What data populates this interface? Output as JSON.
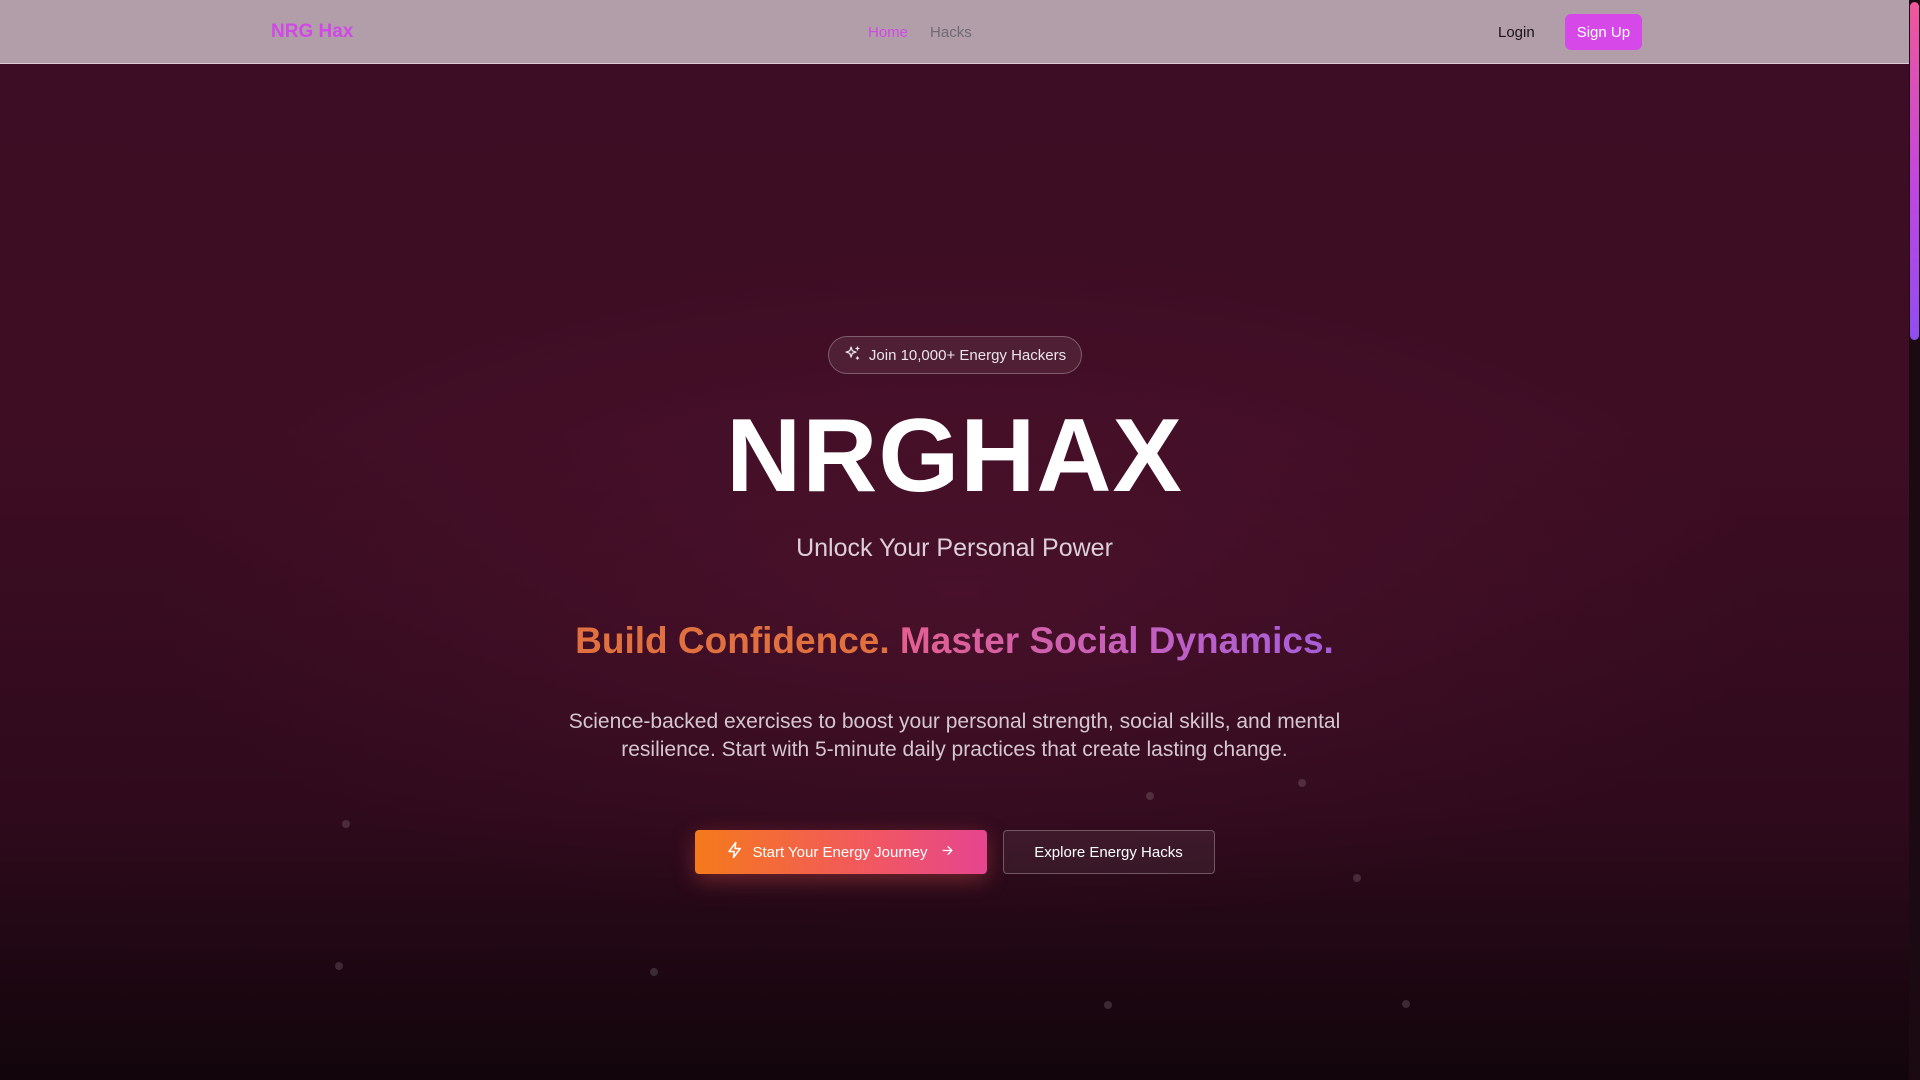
{
  "nav": {
    "brand": "NRG Hax",
    "links": [
      {
        "label": "Home",
        "active": true
      },
      {
        "label": "Hacks",
        "active": false
      }
    ],
    "login_label": "Login",
    "signup_label": "Sign Up"
  },
  "hero": {
    "badge_icon": "sparkles-icon",
    "badge_text": "Join 10,000+ Energy Hackers",
    "title": "NRGHAX",
    "subtitle": "Unlock Your Personal Power",
    "tagline_part1": "Build Confidence.",
    "tagline_part2": "Master Social Dynamics.",
    "description": "Science-backed exercises to boost your personal strength, social skills, and mental resilience. Start with 5-minute daily practices that create lasting change.",
    "primary_cta": {
      "label": "Start Your Energy Journey",
      "icon": "zap-icon",
      "trailing_icon": "arrow-right-icon"
    },
    "secondary_cta": {
      "label": "Explore Energy Hacks"
    }
  },
  "colors": {
    "accent": "#d048e6",
    "signup_bg": "#d649e8",
    "navbar_bg": "#b19ea8",
    "tagline_orange": "#e0703f",
    "cta_gradient_start": "#f57a1b",
    "cta_gradient_end": "#e6458f",
    "hero_bg": "#3c0d24"
  }
}
